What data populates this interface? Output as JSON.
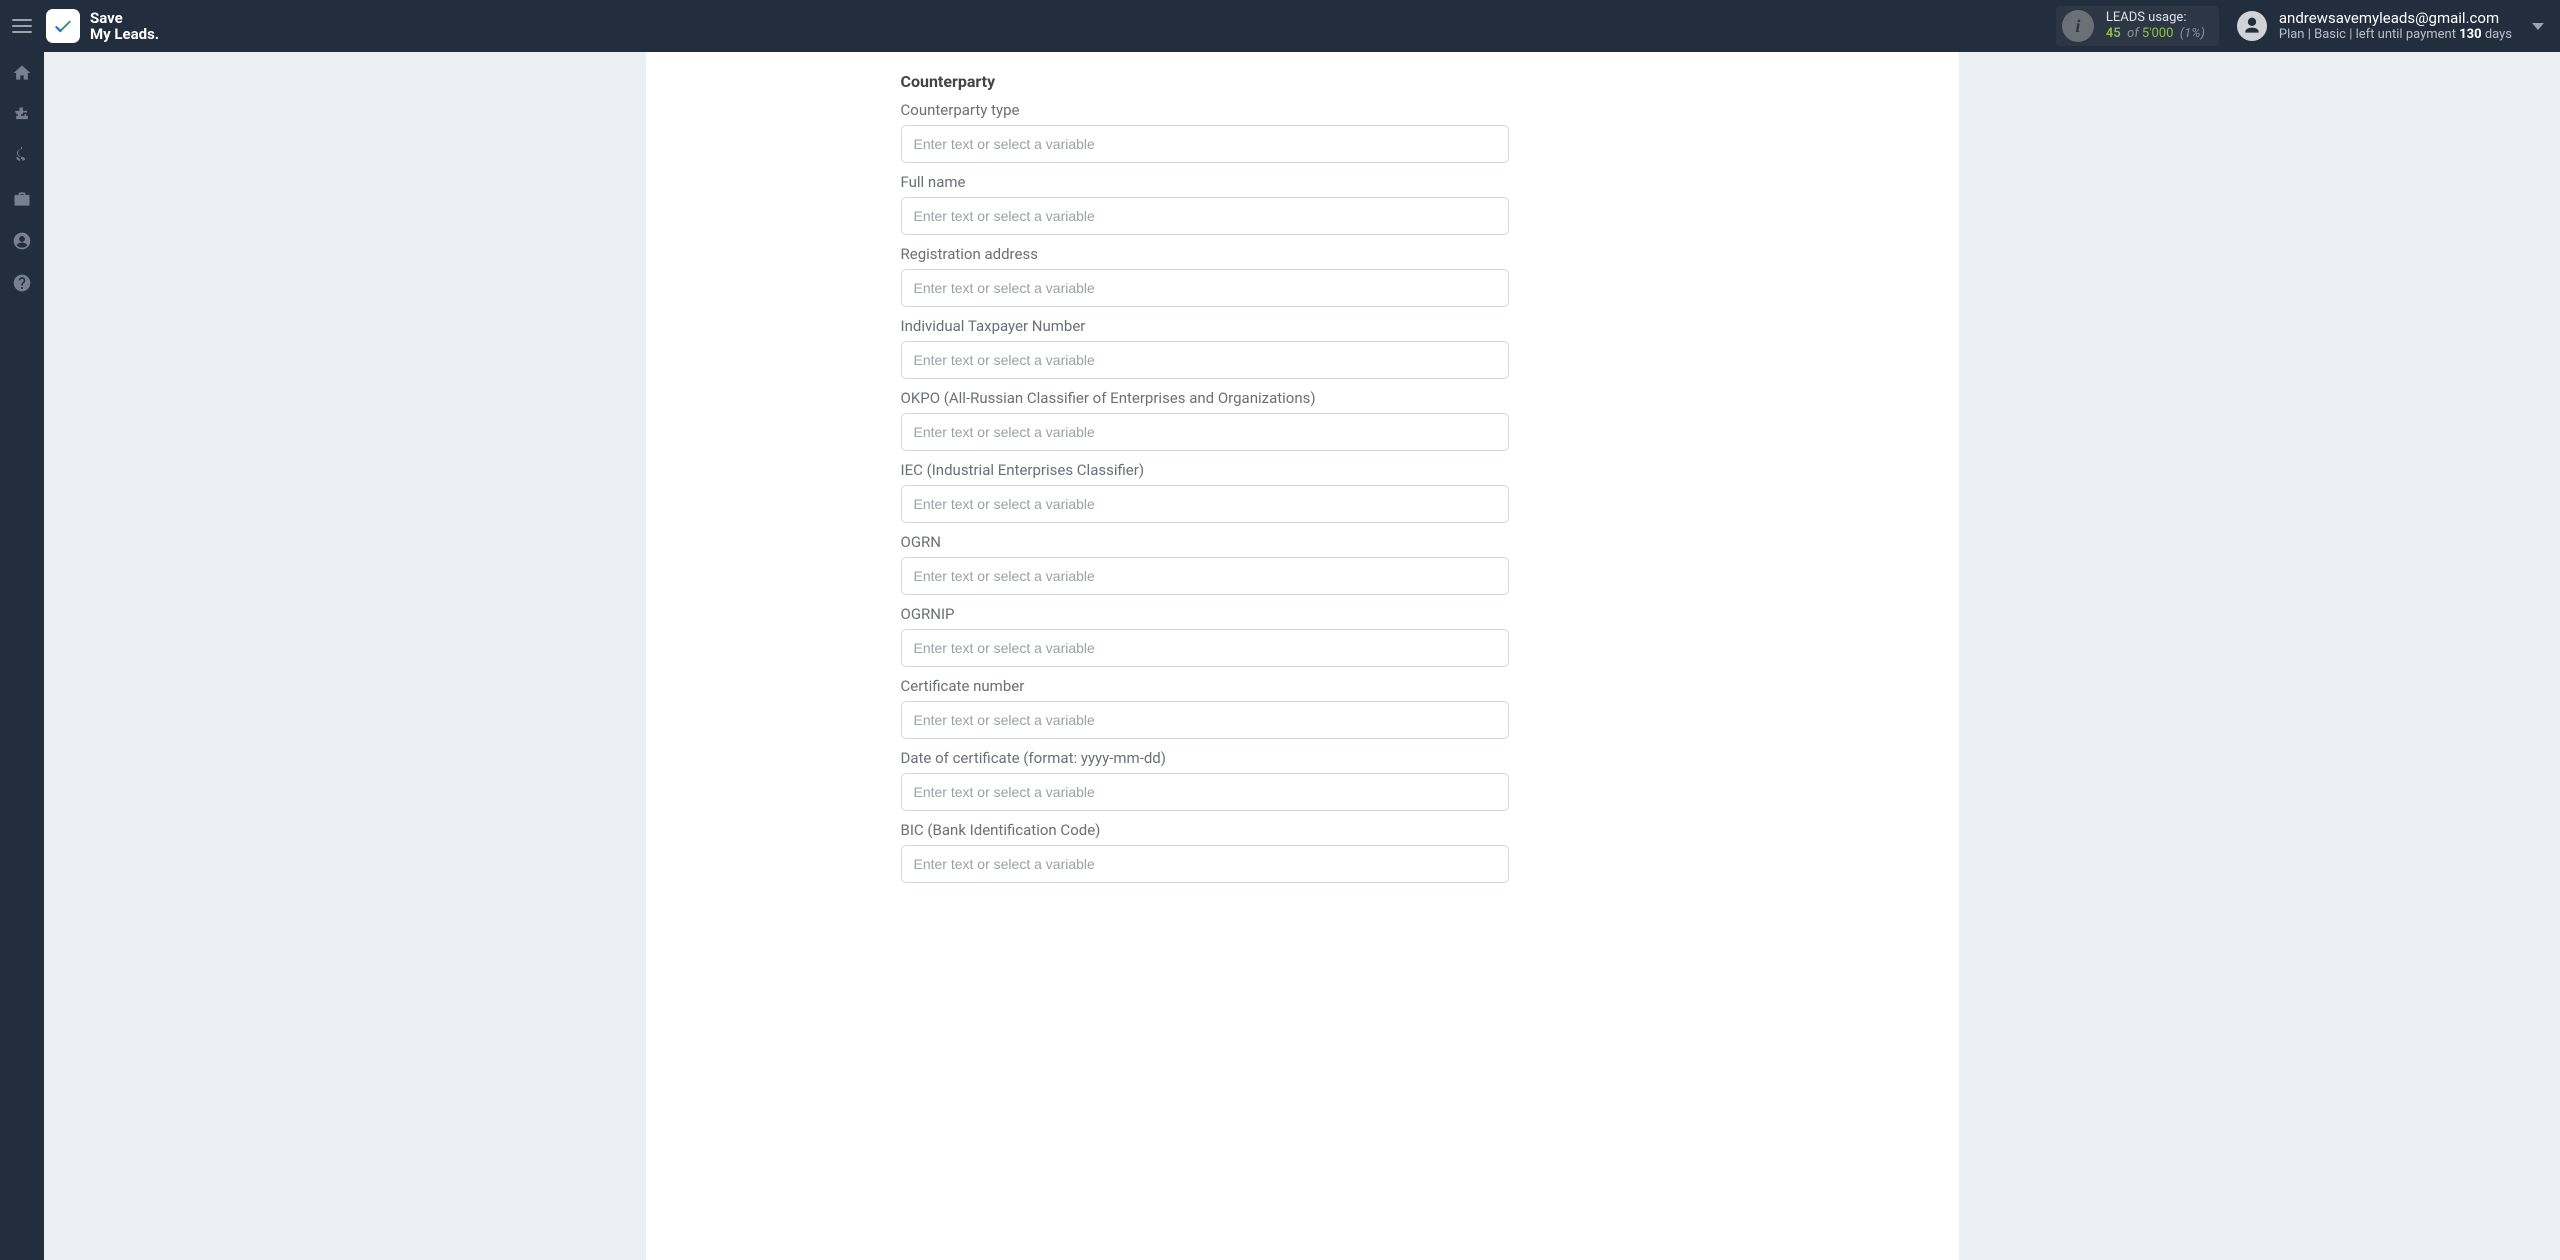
{
  "brand": {
    "line1": "Save",
    "line2": "My Leads."
  },
  "usage": {
    "label": "LEADS usage:",
    "used": "45",
    "of_word": "of",
    "total": "5'000",
    "percent": "(1%)"
  },
  "account": {
    "email": "andrewsavemyleads@gmail.com",
    "plan_prefix": "Plan |",
    "plan_name": "Basic",
    "plan_mid": "| left until payment",
    "days": "130",
    "days_word": "days"
  },
  "form": {
    "section_title": "Counterparty",
    "placeholder": "Enter text or select a variable",
    "fields": [
      {
        "label": "Counterparty type"
      },
      {
        "label": "Full name"
      },
      {
        "label": "Registration address"
      },
      {
        "label": "Individual Taxpayer Number"
      },
      {
        "label": "OKPO (All-Russian Classifier of Enterprises and Organizations)"
      },
      {
        "label": "IEC (Industrial Enterprises Classifier)"
      },
      {
        "label": "OGRN"
      },
      {
        "label": "OGRNIP"
      },
      {
        "label": "Certificate number"
      },
      {
        "label": "Date of certificate (format: yyyy-mm-dd)"
      },
      {
        "label": "BIC (Bank Identification Code)"
      }
    ]
  },
  "sidebar": {
    "items": [
      {
        "name": "home"
      },
      {
        "name": "connections"
      },
      {
        "name": "billing"
      },
      {
        "name": "work"
      },
      {
        "name": "profile"
      },
      {
        "name": "help"
      }
    ]
  }
}
